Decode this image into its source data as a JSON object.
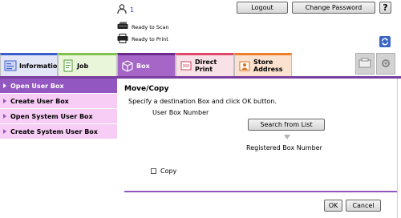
{
  "header": {
    "user_name": "1",
    "logout_label": "Logout",
    "change_password_label": "Change Password",
    "help_label": "?",
    "status_scan": "Ready to Scan",
    "status_print": "Ready to Print"
  },
  "tabs": [
    {
      "label": "Information",
      "icon": "info-icon"
    },
    {
      "label": "Job",
      "icon": "job-icon"
    },
    {
      "label": "Box",
      "icon": "box-icon"
    },
    {
      "label": "Direct Print",
      "icon": "print-icon"
    },
    {
      "label": "Store Address",
      "icon": "store-address-icon"
    }
  ],
  "sidebar": {
    "items": [
      {
        "label": "Open User Box",
        "active": true
      },
      {
        "label": "Create User Box",
        "active": false
      },
      {
        "label": "Open System User Box",
        "active": false
      },
      {
        "label": "Create System User Box",
        "active": false
      }
    ]
  },
  "main": {
    "title": "Move/Copy",
    "description": "Specify a destination Box and click OK button.",
    "user_box_number_label": "User Box Number",
    "search_button": "Search from List",
    "registered_label": "Registered Box Number",
    "copy_label": "Copy",
    "copy_checked": false,
    "ok_label": "OK",
    "cancel_label": "Cancel"
  },
  "colors": {
    "accent_purple": "#9257c1",
    "sidebar_bg": "#f7ccf5",
    "user_link": "#1a3fbf"
  }
}
